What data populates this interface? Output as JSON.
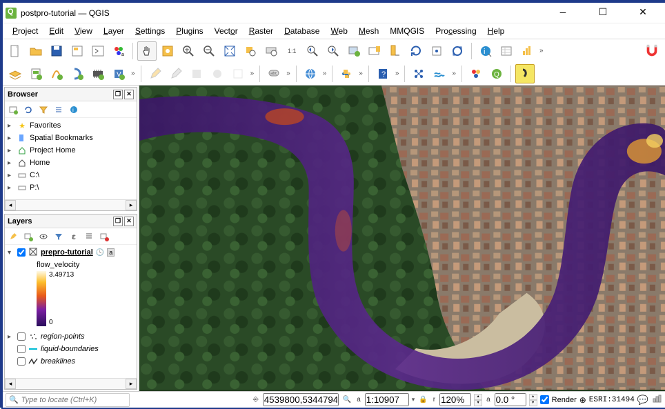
{
  "window": {
    "title": "postpro-tutorial — QGIS"
  },
  "menu": [
    "Project",
    "Edit",
    "View",
    "Layer",
    "Settings",
    "Plugins",
    "Vector",
    "Raster",
    "Database",
    "Web",
    "Mesh",
    "MMQGIS",
    "Processing",
    "Help"
  ],
  "browser": {
    "title": "Browser",
    "items": [
      {
        "icon": "star",
        "label": "Favorites",
        "color": "#f5c518"
      },
      {
        "icon": "bookmark",
        "label": "Spatial Bookmarks",
        "color": "#6aa6ff"
      },
      {
        "icon": "home-proj",
        "label": "Project Home",
        "color": "#2e9e3f"
      },
      {
        "icon": "home",
        "label": "Home",
        "color": "#555"
      },
      {
        "icon": "drive",
        "label": "C:\\",
        "color": "#555"
      },
      {
        "icon": "drive",
        "label": "P:\\",
        "color": "#555"
      }
    ]
  },
  "layers": {
    "title": "Layers",
    "active": {
      "name": "prepro-tutorial",
      "sublabel": "flow_velocity",
      "max": "3.49713",
      "min": "0"
    },
    "others": [
      {
        "name": "region-points",
        "symbol": "points"
      },
      {
        "name": "liquid-boundaries",
        "symbol": "line",
        "color": "#00bcd4"
      },
      {
        "name": "breaklines",
        "symbol": "zigzag"
      }
    ]
  },
  "status": {
    "locate_placeholder": "Type to locate (Ctrl+K)",
    "coord": "4539800,5344794",
    "scale": "1:10907",
    "mag": "120%",
    "rot": "0.0 °",
    "render": "Render",
    "crs": "ESRI:31494"
  },
  "toolbar_overflow": "»"
}
